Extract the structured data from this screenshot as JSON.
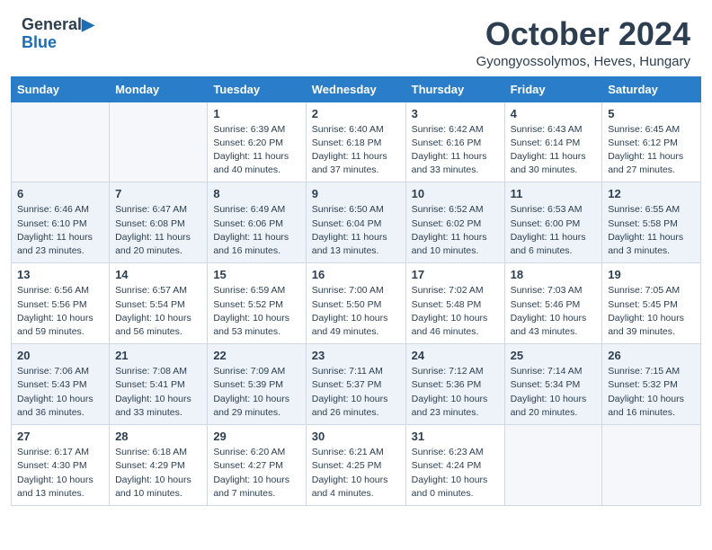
{
  "header": {
    "logo_line1": "General",
    "logo_line2": "Blue",
    "month": "October 2024",
    "location": "Gyongyossolymos, Heves, Hungary"
  },
  "days_of_week": [
    "Sunday",
    "Monday",
    "Tuesday",
    "Wednesday",
    "Thursday",
    "Friday",
    "Saturday"
  ],
  "weeks": [
    [
      {
        "day": "",
        "detail": ""
      },
      {
        "day": "",
        "detail": ""
      },
      {
        "day": "1",
        "detail": "Sunrise: 6:39 AM\nSunset: 6:20 PM\nDaylight: 11 hours and 40 minutes."
      },
      {
        "day": "2",
        "detail": "Sunrise: 6:40 AM\nSunset: 6:18 PM\nDaylight: 11 hours and 37 minutes."
      },
      {
        "day": "3",
        "detail": "Sunrise: 6:42 AM\nSunset: 6:16 PM\nDaylight: 11 hours and 33 minutes."
      },
      {
        "day": "4",
        "detail": "Sunrise: 6:43 AM\nSunset: 6:14 PM\nDaylight: 11 hours and 30 minutes."
      },
      {
        "day": "5",
        "detail": "Sunrise: 6:45 AM\nSunset: 6:12 PM\nDaylight: 11 hours and 27 minutes."
      }
    ],
    [
      {
        "day": "6",
        "detail": "Sunrise: 6:46 AM\nSunset: 6:10 PM\nDaylight: 11 hours and 23 minutes."
      },
      {
        "day": "7",
        "detail": "Sunrise: 6:47 AM\nSunset: 6:08 PM\nDaylight: 11 hours and 20 minutes."
      },
      {
        "day": "8",
        "detail": "Sunrise: 6:49 AM\nSunset: 6:06 PM\nDaylight: 11 hours and 16 minutes."
      },
      {
        "day": "9",
        "detail": "Sunrise: 6:50 AM\nSunset: 6:04 PM\nDaylight: 11 hours and 13 minutes."
      },
      {
        "day": "10",
        "detail": "Sunrise: 6:52 AM\nSunset: 6:02 PM\nDaylight: 11 hours and 10 minutes."
      },
      {
        "day": "11",
        "detail": "Sunrise: 6:53 AM\nSunset: 6:00 PM\nDaylight: 11 hours and 6 minutes."
      },
      {
        "day": "12",
        "detail": "Sunrise: 6:55 AM\nSunset: 5:58 PM\nDaylight: 11 hours and 3 minutes."
      }
    ],
    [
      {
        "day": "13",
        "detail": "Sunrise: 6:56 AM\nSunset: 5:56 PM\nDaylight: 10 hours and 59 minutes."
      },
      {
        "day": "14",
        "detail": "Sunrise: 6:57 AM\nSunset: 5:54 PM\nDaylight: 10 hours and 56 minutes."
      },
      {
        "day": "15",
        "detail": "Sunrise: 6:59 AM\nSunset: 5:52 PM\nDaylight: 10 hours and 53 minutes."
      },
      {
        "day": "16",
        "detail": "Sunrise: 7:00 AM\nSunset: 5:50 PM\nDaylight: 10 hours and 49 minutes."
      },
      {
        "day": "17",
        "detail": "Sunrise: 7:02 AM\nSunset: 5:48 PM\nDaylight: 10 hours and 46 minutes."
      },
      {
        "day": "18",
        "detail": "Sunrise: 7:03 AM\nSunset: 5:46 PM\nDaylight: 10 hours and 43 minutes."
      },
      {
        "day": "19",
        "detail": "Sunrise: 7:05 AM\nSunset: 5:45 PM\nDaylight: 10 hours and 39 minutes."
      }
    ],
    [
      {
        "day": "20",
        "detail": "Sunrise: 7:06 AM\nSunset: 5:43 PM\nDaylight: 10 hours and 36 minutes."
      },
      {
        "day": "21",
        "detail": "Sunrise: 7:08 AM\nSunset: 5:41 PM\nDaylight: 10 hours and 33 minutes."
      },
      {
        "day": "22",
        "detail": "Sunrise: 7:09 AM\nSunset: 5:39 PM\nDaylight: 10 hours and 29 minutes."
      },
      {
        "day": "23",
        "detail": "Sunrise: 7:11 AM\nSunset: 5:37 PM\nDaylight: 10 hours and 26 minutes."
      },
      {
        "day": "24",
        "detail": "Sunrise: 7:12 AM\nSunset: 5:36 PM\nDaylight: 10 hours and 23 minutes."
      },
      {
        "day": "25",
        "detail": "Sunrise: 7:14 AM\nSunset: 5:34 PM\nDaylight: 10 hours and 20 minutes."
      },
      {
        "day": "26",
        "detail": "Sunrise: 7:15 AM\nSunset: 5:32 PM\nDaylight: 10 hours and 16 minutes."
      }
    ],
    [
      {
        "day": "27",
        "detail": "Sunrise: 6:17 AM\nSunset: 4:30 PM\nDaylight: 10 hours and 13 minutes."
      },
      {
        "day": "28",
        "detail": "Sunrise: 6:18 AM\nSunset: 4:29 PM\nDaylight: 10 hours and 10 minutes."
      },
      {
        "day": "29",
        "detail": "Sunrise: 6:20 AM\nSunset: 4:27 PM\nDaylight: 10 hours and 7 minutes."
      },
      {
        "day": "30",
        "detail": "Sunrise: 6:21 AM\nSunset: 4:25 PM\nDaylight: 10 hours and 4 minutes."
      },
      {
        "day": "31",
        "detail": "Sunrise: 6:23 AM\nSunset: 4:24 PM\nDaylight: 10 hours and 0 minutes."
      },
      {
        "day": "",
        "detail": ""
      },
      {
        "day": "",
        "detail": ""
      }
    ]
  ]
}
